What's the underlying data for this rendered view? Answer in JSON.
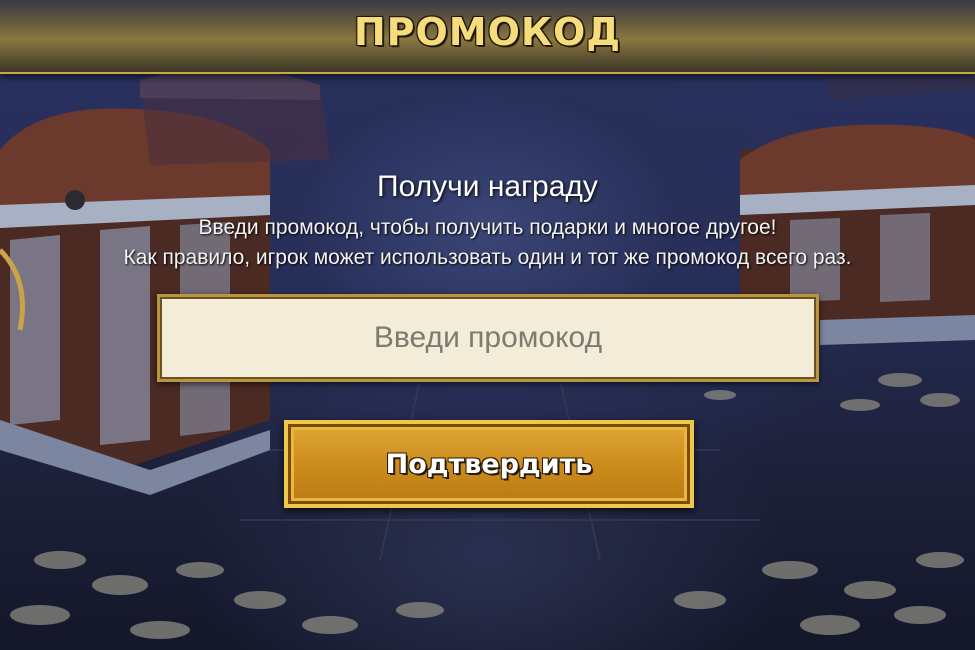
{
  "header": {
    "title": "ПРОМОКОД"
  },
  "main": {
    "reward_title": "Получи награду",
    "description_line1": "Введи промокод, чтобы получить подарки и многое другое!",
    "description_line2": "Как правило, игрок может использовать один и тот же промокод всего раз."
  },
  "promo_form": {
    "input_placeholder": "Введи промокод",
    "input_value": "",
    "confirm_label": "Подтвердить"
  },
  "colors": {
    "header_text": "#f6dc7a",
    "button_gold": "#cf8f1e",
    "input_bg": "#f3ecd8",
    "background": "#252b52"
  },
  "icons": {
    "left_decoration": "treasure-chest-icon",
    "right_decoration": "treasure-chest-icon",
    "floor_decoration": "gold-coins-icon"
  }
}
